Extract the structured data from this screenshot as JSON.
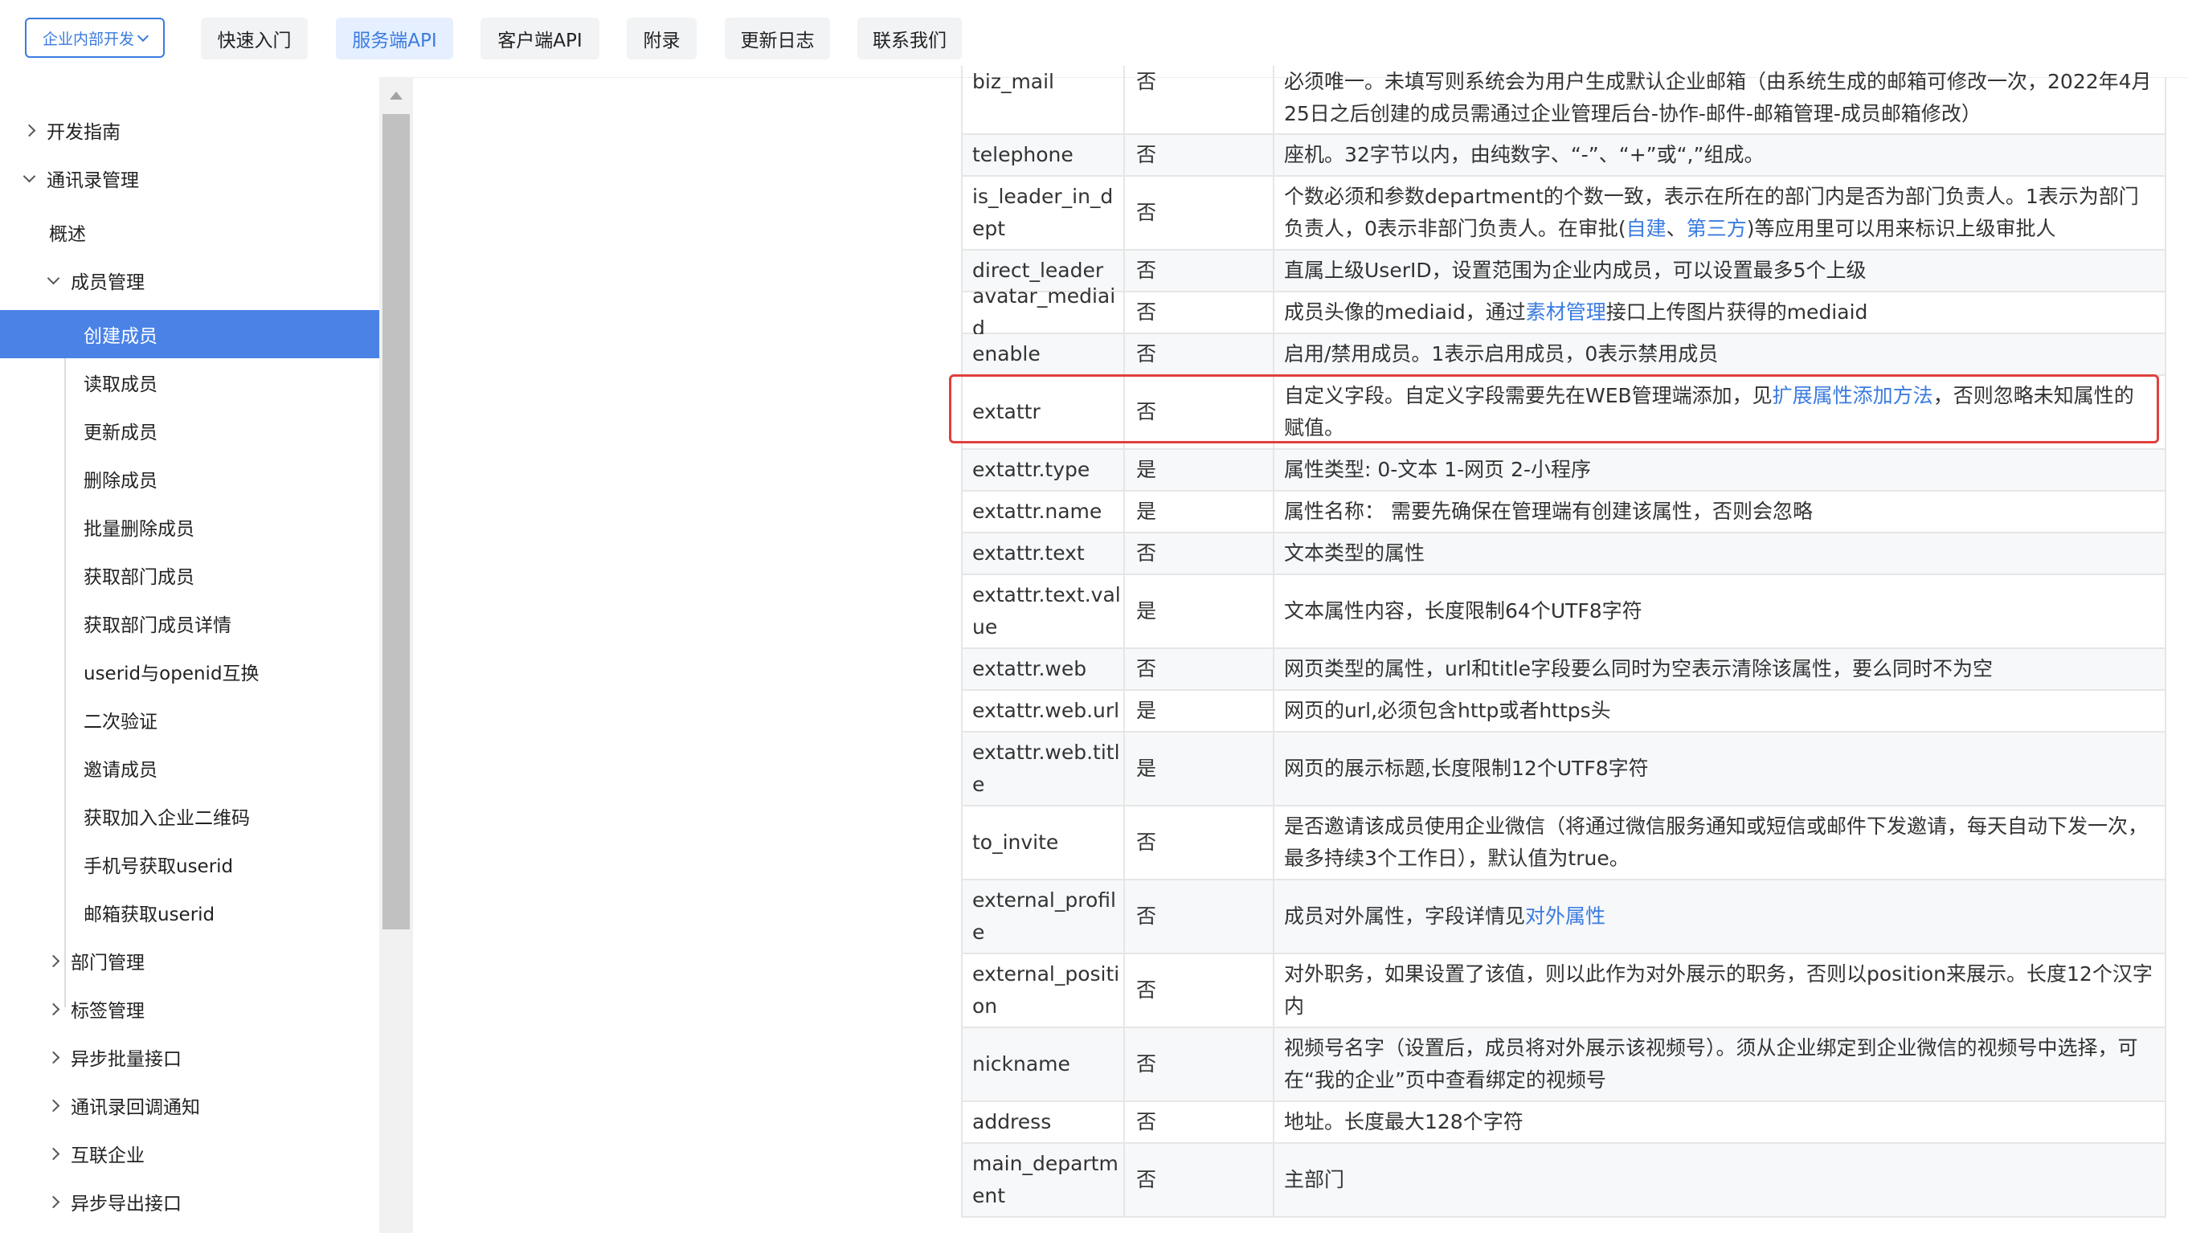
{
  "header": {
    "env_select": "企业内部开发",
    "tabs": [
      "快速入门",
      "服务端API",
      "客户端API",
      "附录",
      "更新日志",
      "联系我们"
    ],
    "active_tab": "服务端API"
  },
  "sidebar": {
    "items": [
      {
        "label": "开发指南"
      },
      {
        "label": "通讯录管理"
      },
      {
        "label": "概述"
      },
      {
        "label": "成员管理"
      },
      {
        "label": "创建成员"
      },
      {
        "label": "读取成员"
      },
      {
        "label": "更新成员"
      },
      {
        "label": "删除成员"
      },
      {
        "label": "批量删除成员"
      },
      {
        "label": "获取部门成员"
      },
      {
        "label": "获取部门成员详情"
      },
      {
        "label": "userid与openid互换"
      },
      {
        "label": "二次验证"
      },
      {
        "label": "邀请成员"
      },
      {
        "label": "获取加入企业二维码"
      },
      {
        "label": "手机号获取userid"
      },
      {
        "label": "邮箱获取userid"
      },
      {
        "label": "部门管理"
      },
      {
        "label": "标签管理"
      },
      {
        "label": "异步批量接口"
      },
      {
        "label": "通讯录回调通知"
      },
      {
        "label": "互联企业"
      },
      {
        "label": "异步导出接口"
      }
    ]
  },
  "table": {
    "rows": [
      {
        "param": "biz_mail",
        "required": "否",
        "desc": "必须唯一。未填写则系统会为用户生成默认企业邮箱（由系统生成的邮箱可修改一次，2022年4月25日之后创建的成员需通过企业管理后台-协作-邮件-邮箱管理-成员邮箱修改）"
      },
      {
        "param": "telephone",
        "required": "否",
        "desc": "座机。32字节以内，由纯数字、“-”、“+”或“,”组成。"
      },
      {
        "param": "is_leader_in_dept",
        "required": "否",
        "desc_pre": "个数必须和参数department的个数一致，表示在所在的部门内是否为部门负责人。1表示为部门负责人，0表示非部门负责人。在审批(",
        "link1": "自建",
        "sep": "、",
        "link2": "第三方",
        "desc_post": ")等应用里可以用来标识上级审批人"
      },
      {
        "param": "direct_leader",
        "required": "否",
        "desc": "直属上级UserID，设置范围为企业内成员，可以设置最多5个上级"
      },
      {
        "param": "avatar_mediaid",
        "required": "否",
        "desc_pre": "成员头像的mediaid，通过",
        "link": "素材管理",
        "desc_post": "接口上传图片获得的mediaid"
      },
      {
        "param": "enable",
        "required": "否",
        "desc": "启用/禁用成员。1表示启用成员，0表示禁用成员"
      },
      {
        "param": "extattr",
        "required": "否",
        "desc_pre": "自定义字段。自定义字段需要先在WEB管理端添加，见",
        "link": "扩展属性添加方法",
        "desc_post": "，否则忽略未知属性的赋值。"
      },
      {
        "param": "extattr.type",
        "required": "是",
        "desc": "属性类型: 0-文本 1-网页 2-小程序"
      },
      {
        "param": "extattr.name",
        "required": "是",
        "desc": "属性名称： 需要先确保在管理端有创建该属性，否则会忽略"
      },
      {
        "param": "extattr.text",
        "required": "否",
        "desc": "文本类型的属性"
      },
      {
        "param": "extattr.text.value",
        "required": "是",
        "desc": "文本属性内容，长度限制64个UTF8字符"
      },
      {
        "param": "extattr.web",
        "required": "否",
        "desc": "网页类型的属性，url和title字段要么同时为空表示清除该属性，要么同时不为空"
      },
      {
        "param": "extattr.web.url",
        "required": "是",
        "desc": "网页的url,必须包含http或者https头"
      },
      {
        "param": "extattr.web.title",
        "required": "是",
        "desc": "网页的展示标题,长度限制12个UTF8字符"
      },
      {
        "param": "to_invite",
        "required": "否",
        "desc": "是否邀请该成员使用企业微信（将通过微信服务通知或短信或邮件下发邀请，每天自动下发一次，最多持续3个工作日），默认值为true。"
      },
      {
        "param": "external_profile",
        "required": "否",
        "desc_pre": "成员对外属性，字段详情见",
        "link": "对外属性",
        "desc_post": ""
      },
      {
        "param": "external_position",
        "required": "否",
        "desc": "对外职务，如果设置了该值，则以此作为对外展示的职务，否则以position来展示。长度12个汉字内"
      },
      {
        "param": "nickname",
        "required": "否",
        "desc": "视频号名字（设置后，成员将对外展示该视频号）。须从企业绑定到企业微信的视频号中选择，可在“我的企业”页中查看绑定的视频号"
      },
      {
        "param": "address",
        "required": "否",
        "desc": "地址。长度最大128个字符"
      },
      {
        "param": "main_department",
        "required": "否",
        "desc": "主部门"
      }
    ]
  }
}
